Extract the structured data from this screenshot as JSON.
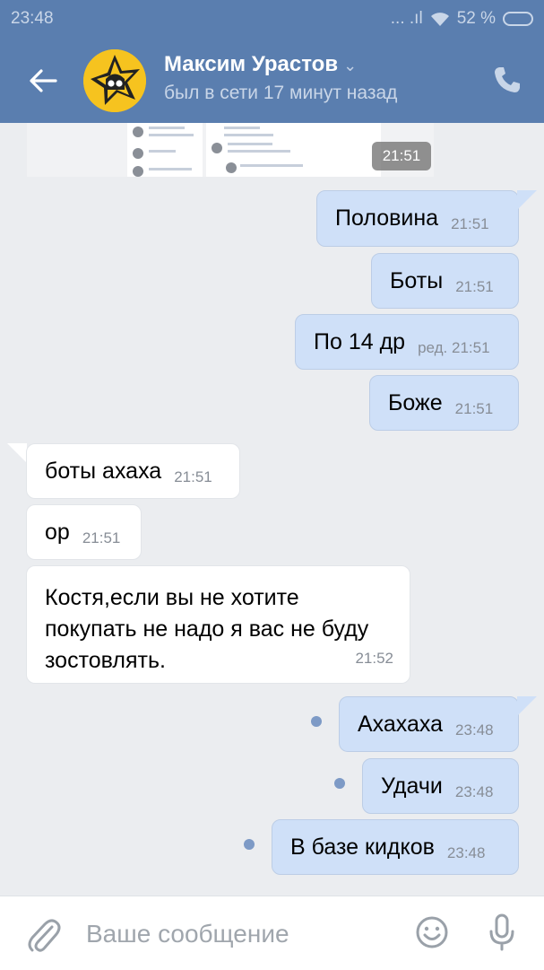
{
  "status_bar": {
    "time": "23:48",
    "signal": "... .ıl",
    "battery": "52 %"
  },
  "header": {
    "name": "Максим Урастов",
    "status": "был в сети 17 минут назад",
    "avatar": "brawl-stars-star-avatar",
    "chevron": "⌄"
  },
  "photo_message": {
    "time": "21:51"
  },
  "messages": [
    {
      "side": "out",
      "text": "Половина",
      "time": "21:51",
      "edited": ""
    },
    {
      "side": "out",
      "text": "Боты",
      "time": "21:51",
      "edited": ""
    },
    {
      "side": "out",
      "text": "По 14 др",
      "time": "21:51",
      "edited": "ред."
    },
    {
      "side": "out",
      "text": "Боже",
      "time": "21:51",
      "edited": ""
    },
    {
      "side": "in",
      "text": "боты ахаха",
      "time": "21:51"
    },
    {
      "side": "in",
      "text": "ор",
      "time": "21:51"
    },
    {
      "side": "in",
      "text": "Костя,если вы не хотите покупать не надо я вас не буду зостовлять.",
      "time": "21:52"
    },
    {
      "side": "out",
      "text": "Ахахаха",
      "time": "23:48",
      "unread": true
    },
    {
      "side": "out",
      "text": "Удачи",
      "time": "23:48",
      "unread": true
    },
    {
      "side": "out",
      "text": "В базе кидков",
      "time": "23:48",
      "unread": true
    }
  ],
  "input": {
    "placeholder": "Ваше сообщение"
  },
  "colors": {
    "header": "#5a7eaf",
    "outgoing": "#cfe0f8",
    "incoming": "#ffffff",
    "background": "#ebedf0"
  }
}
